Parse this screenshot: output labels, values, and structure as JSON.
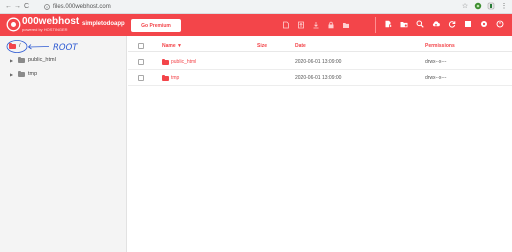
{
  "browser": {
    "url": "files.000webhost.com",
    "back_glyph": "←",
    "forward_glyph": "→",
    "reload_glyph": "C",
    "star_glyph": "☆",
    "menu_glyph": "⋮"
  },
  "header": {
    "brand_name": "000webhost",
    "brand_sub": "powered by HOSTINGER",
    "site_name": "simpletodoapp",
    "premium_label": "Go Premium",
    "tools_a": [
      "new-file-icon",
      "upload-file-icon",
      "download-icon",
      "lock-icon",
      "folder-icon"
    ],
    "tools_b": [
      "new-folder-icon",
      "move-icon",
      "search-icon",
      "upload-cloud-icon",
      "refresh-icon",
      "grid-icon",
      "settings-icon",
      "exit-icon"
    ]
  },
  "sidebar": {
    "root_label": "/",
    "annotation_text": "ROOT",
    "tree": [
      {
        "label": "public_html",
        "expand_glyph": "▶"
      },
      {
        "label": "tmp",
        "expand_glyph": "▶"
      }
    ]
  },
  "table": {
    "columns": {
      "name": "Name ▼",
      "size": "Size",
      "date": "Date",
      "permissions": "Permissions"
    },
    "rows": [
      {
        "name": "public_html",
        "size": "",
        "date": "2020-06-01 13:09:00",
        "permissions": "drwx--x---"
      },
      {
        "name": "tmp",
        "size": "",
        "date": "2020-06-01 13:09:00",
        "permissions": "drwx--x---"
      }
    ]
  },
  "colors": {
    "accent": "#f3454a",
    "sidebar_bg": "#f4f4f4",
    "annotation_ink": "#2f5bd3"
  }
}
